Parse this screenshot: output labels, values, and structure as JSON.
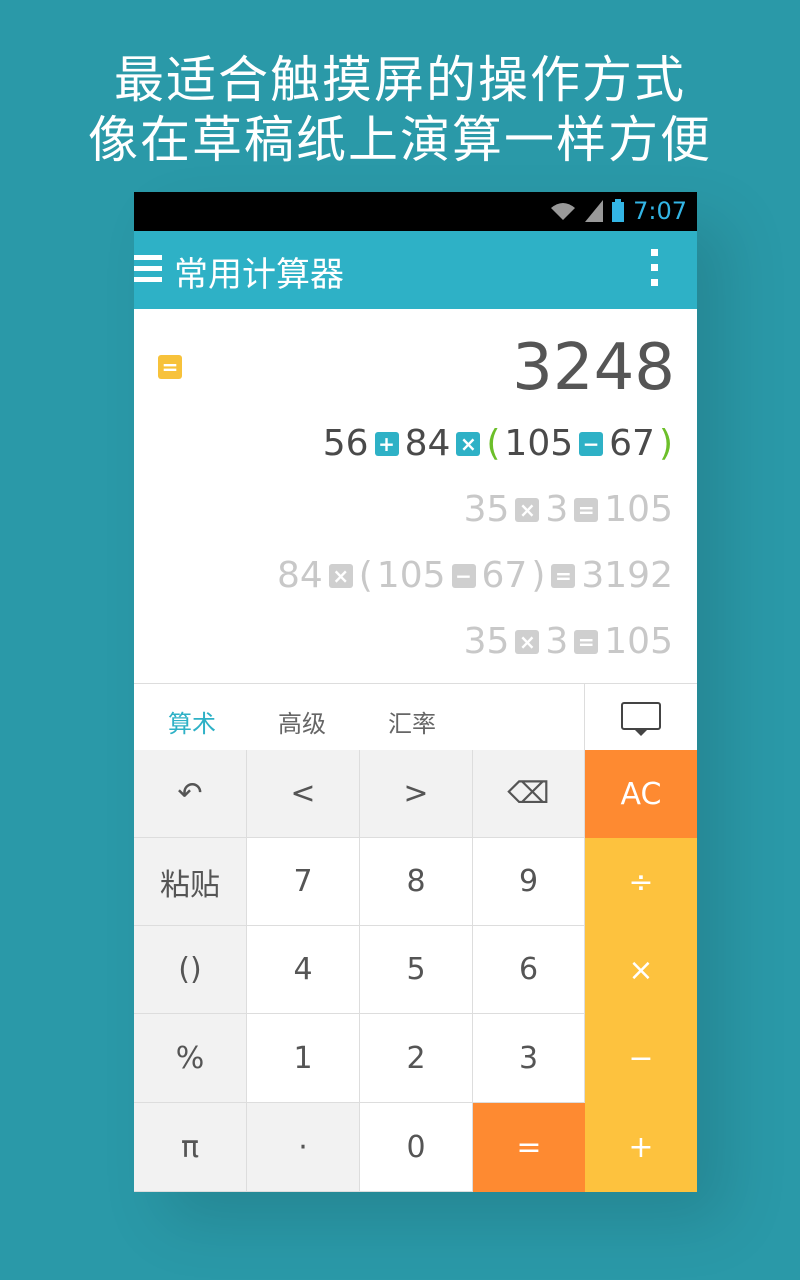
{
  "promo": {
    "line1": "最适合触摸屏的操作方式",
    "line2": "像在草稿纸上演算一样方便"
  },
  "status": {
    "time": "7:07",
    "icons": [
      "wifi-icon",
      "signal-icon",
      "battery-icon"
    ]
  },
  "appbar": {
    "title": "常用计算器",
    "icons": [
      "menu-icon",
      "overflow-icon"
    ]
  },
  "display": {
    "result_badge": "=",
    "result": "3248",
    "current_expression": {
      "a": "56",
      "op1": "+",
      "b": "84",
      "op2": "×",
      "paren_open": "(",
      "c": "105",
      "op3": "−",
      "d": "67",
      "paren_close": ")"
    },
    "history": [
      {
        "a": "35",
        "op": "×",
        "b": "3",
        "eq": "=",
        "r": "105"
      },
      {
        "a": "84",
        "op": "×",
        "p1": "(",
        "b": "105",
        "op2": "−",
        "c": "67",
        "p2": ")",
        "eq": "=",
        "r": "3192"
      },
      {
        "a": "35",
        "op": "×",
        "b": "3",
        "eq": "=",
        "r": "105"
      }
    ]
  },
  "tabs": [
    "算术",
    "高级",
    "汇率"
  ],
  "keyboard_icon": "keyboard-icon",
  "keys": {
    "undo": "↶",
    "left": "<",
    "right": ">",
    "backspace": "⌫",
    "ac": "AC",
    "paste": "粘贴",
    "seven": "7",
    "eight": "8",
    "nine": "9",
    "divide": "÷",
    "parens": "()",
    "four": "4",
    "five": "5",
    "six": "6",
    "multiply": "×",
    "percent": "%",
    "one": "1",
    "two": "2",
    "three": "3",
    "minus": "−",
    "pi": "π",
    "dot": "·",
    "zero": "0",
    "equals": "=",
    "plus": "+"
  },
  "colors": {
    "background": "#2a99a8",
    "appbar": "#2eb1c6",
    "orange": "#fe8a31",
    "yellow": "#fdc23e"
  }
}
